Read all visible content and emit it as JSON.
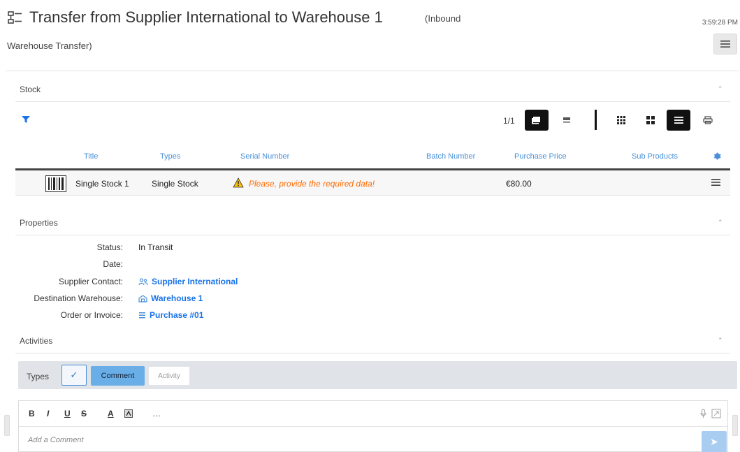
{
  "header": {
    "title": "Transfer from Supplier International to Warehouse 1",
    "subtitle_part1": "(Inbound",
    "subtitle_part2": "Warehouse Transfer)",
    "time": "3:59:28 PM"
  },
  "stock": {
    "section_title": "Stock",
    "pager": "1/1",
    "columns": [
      "Title",
      "Types",
      "Serial Number",
      "Batch Number",
      "Purchase Price",
      "Sub Products"
    ],
    "rows": [
      {
        "title": "Single Stock 1",
        "type": "Single Stock",
        "serial_warning": "Please, provide the required data!",
        "batch": "",
        "price": "€80.00",
        "sub_products": ""
      }
    ]
  },
  "properties": {
    "section_title": "Properties",
    "fields": [
      {
        "label": "Status:",
        "value": "In Transit"
      },
      {
        "label": "Date:",
        "value": ""
      },
      {
        "label": "Supplier Contact:",
        "value": "Supplier International"
      },
      {
        "label": "Destination Warehouse:",
        "value": "Warehouse 1"
      },
      {
        "label": "Order or Invoice:",
        "value": "Purchase #01"
      }
    ]
  },
  "activities": {
    "section_title": "Activities",
    "types_label": "Types",
    "filters": [
      "Comment",
      "Activity"
    ],
    "editor_tools": [
      "B",
      "I",
      "U",
      "S",
      "A",
      "…"
    ],
    "placeholder": "Add a Comment"
  },
  "colors": {
    "accent": "#1a73e8",
    "header_link": "#4a90d9",
    "warning": "#ff6a00",
    "comment_active": "#6aaee8"
  },
  "icons": {
    "header": "transfer-icon",
    "filter": "filter-icon",
    "barcode": "barcode-icon",
    "warning": "warning-icon",
    "settings": "gear-icon"
  }
}
